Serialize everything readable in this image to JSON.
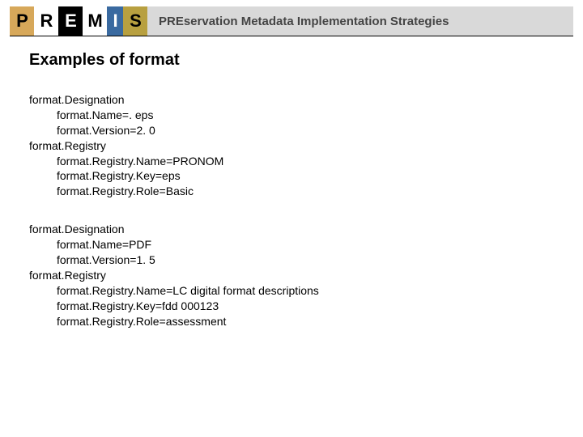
{
  "banner": {
    "logo_letters": [
      "P",
      "R",
      "E",
      "M",
      "I",
      "S"
    ],
    "tagline": "PREservation Metadata Implementation Strategies"
  },
  "title": "Examples of format",
  "blocks": [
    {
      "lines": [
        {
          "indent": 0,
          "text": "format.Designation"
        },
        {
          "indent": 1,
          "text": "format.Name=. eps"
        },
        {
          "indent": 1,
          "text": "format.Version=2. 0"
        },
        {
          "indent": 0,
          "text": "format.Registry"
        },
        {
          "indent": 1,
          "text": "format.Registry.Name=PRONOM"
        },
        {
          "indent": 1,
          "text": "format.Registry.Key=eps"
        },
        {
          "indent": 1,
          "text": "format.Registry.Role=Basic"
        }
      ]
    },
    {
      "lines": [
        {
          "indent": 0,
          "text": "format.Designation"
        },
        {
          "indent": 1,
          "text": "format.Name=PDF"
        },
        {
          "indent": 1,
          "text": "format.Version=1. 5"
        },
        {
          "indent": 0,
          "text": "format.Registry"
        },
        {
          "indent": 1,
          "text": "format.Registry.Name=LC digital format descriptions"
        },
        {
          "indent": 1,
          "text": "format.Registry.Key=fdd 000123"
        },
        {
          "indent": 1,
          "text": "format.Registry.Role=assessment"
        }
      ]
    }
  ]
}
